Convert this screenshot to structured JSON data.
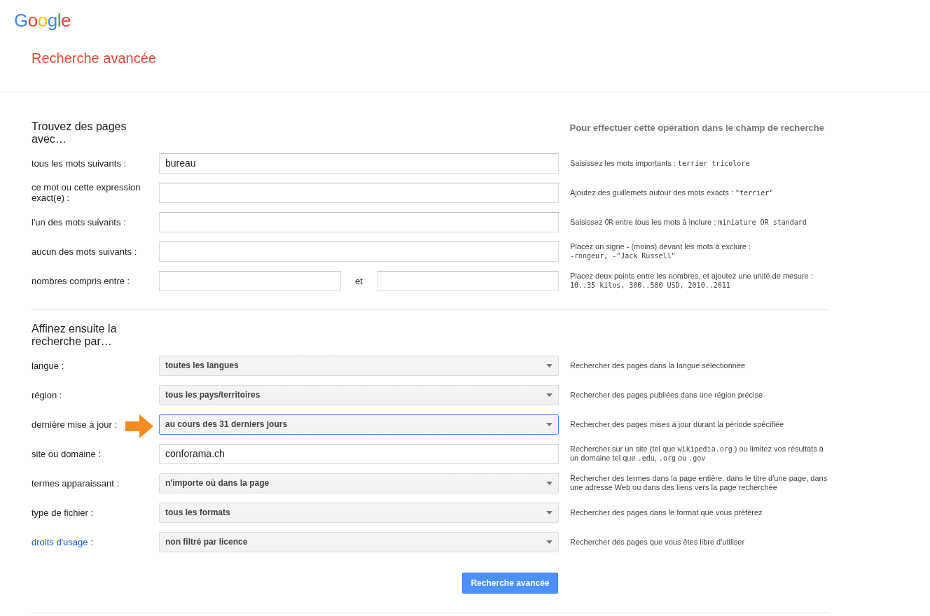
{
  "logo": "Google",
  "title": "Recherche avancée",
  "section_1": {
    "heading": "Trouvez des pages avec…",
    "hint_header": "Pour effectuer cette opération dans le champ de recherche",
    "rows": [
      {
        "kind": "text",
        "label": "tous les mots suivants :",
        "value": "bureau",
        "hint": [
          {
            "kind": "text",
            "text": "Saisissez les mots importants : "
          },
          {
            "kind": "code",
            "text": "terrier tricolore"
          }
        ]
      },
      {
        "kind": "text",
        "label": "ce mot ou cette expression exact(e) :",
        "hint": [
          {
            "kind": "text",
            "text": "Ajoutez des guillemets autour des mots exacts : "
          },
          {
            "kind": "code",
            "text": "\"terrier\""
          }
        ]
      },
      {
        "kind": "text",
        "label": "l'un des mots suivants :",
        "hint": [
          {
            "kind": "text",
            "text": "Saisissez "
          },
          {
            "kind": "code",
            "text": "OR"
          },
          {
            "kind": "text",
            "text": " entre tous les mots à inclure : "
          },
          {
            "kind": "code",
            "text": "miniature OR standard"
          }
        ]
      },
      {
        "kind": "text",
        "label": "aucun des mots suivants :",
        "hint": [
          {
            "kind": "text",
            "text": "Placez un signe - (moins) devant les mots à exclure : "
          },
          {
            "kind": "code_line",
            "text": "-rongeur, -\"Jack Russell\""
          }
        ]
      },
      {
        "kind": "range",
        "label": "nombres compris entre :",
        "between": "et",
        "hint": [
          {
            "kind": "text",
            "text": "Placez deux points entre les nombres, et ajoutez une unité de mesure : "
          },
          {
            "kind": "code_line",
            "text": "10..35 kilos, 300..500 USD, 2010..2011"
          }
        ]
      }
    ]
  },
  "section_2": {
    "heading": "Affinez ensuite la recherche par…",
    "rows": [
      {
        "kind": "select",
        "label": "langue :",
        "value": "toutes les langues",
        "focused": false,
        "arrow": false,
        "hint": [
          {
            "kind": "text",
            "text": "Rechercher des pages dans la langue sélectionnée"
          }
        ]
      },
      {
        "kind": "select",
        "label": "région :",
        "value": "tous les pays/territoires",
        "focused": false,
        "arrow": false,
        "hint": [
          {
            "kind": "text",
            "text": "Rechercher des pages publiées dans une région précise"
          }
        ]
      },
      {
        "kind": "select",
        "label": "dernière mise à jour :",
        "value": "au cours des 31 derniers jours",
        "focused": true,
        "arrow": true,
        "hint": [
          {
            "kind": "text",
            "text": "Rechercher des pages mises à jour durant la période spécifiée"
          }
        ]
      },
      {
        "kind": "text",
        "label": "site ou domaine :",
        "value": "conforama.ch",
        "arrow": false,
        "hint": [
          {
            "kind": "text",
            "text": "Rechercher sur un site (tel que "
          },
          {
            "kind": "code",
            "text": "wikipedia.org"
          },
          {
            "kind": "text",
            "text": " ) ou limitez vos résultats à un domaine tel que "
          },
          {
            "kind": "code",
            "text": ".edu"
          },
          {
            "kind": "text",
            "text": ", "
          },
          {
            "kind": "code",
            "text": ".org"
          },
          {
            "kind": "text",
            "text": " ou "
          },
          {
            "kind": "code",
            "text": ".gov"
          }
        ]
      },
      {
        "kind": "select",
        "label": "termes apparaissant :",
        "value": "n'importe où dans la page",
        "focused": false,
        "arrow": false,
        "hint": [
          {
            "kind": "text",
            "text": "Rechercher des termes dans la page entière, dans le titre d'une page, dans une adresse Web ou dans des liens vers la page recherchée"
          }
        ]
      },
      {
        "kind": "select",
        "label": "type de fichier :",
        "value": "tous les formats",
        "focused": false,
        "arrow": false,
        "hint": [
          {
            "kind": "text",
            "text": "Rechercher des pages dans le format que vous préférez"
          }
        ]
      },
      {
        "kind": "select",
        "label": "droits d'usage",
        "label_link": true,
        "label_suffix": " :",
        "value": "non filtré par licence",
        "focused": false,
        "arrow": false,
        "hint": [
          {
            "kind": "text",
            "text": "Rechercher des pages que vous êtes libre d'utiliser"
          }
        ]
      }
    ]
  },
  "submit": "Recherche avancée"
}
